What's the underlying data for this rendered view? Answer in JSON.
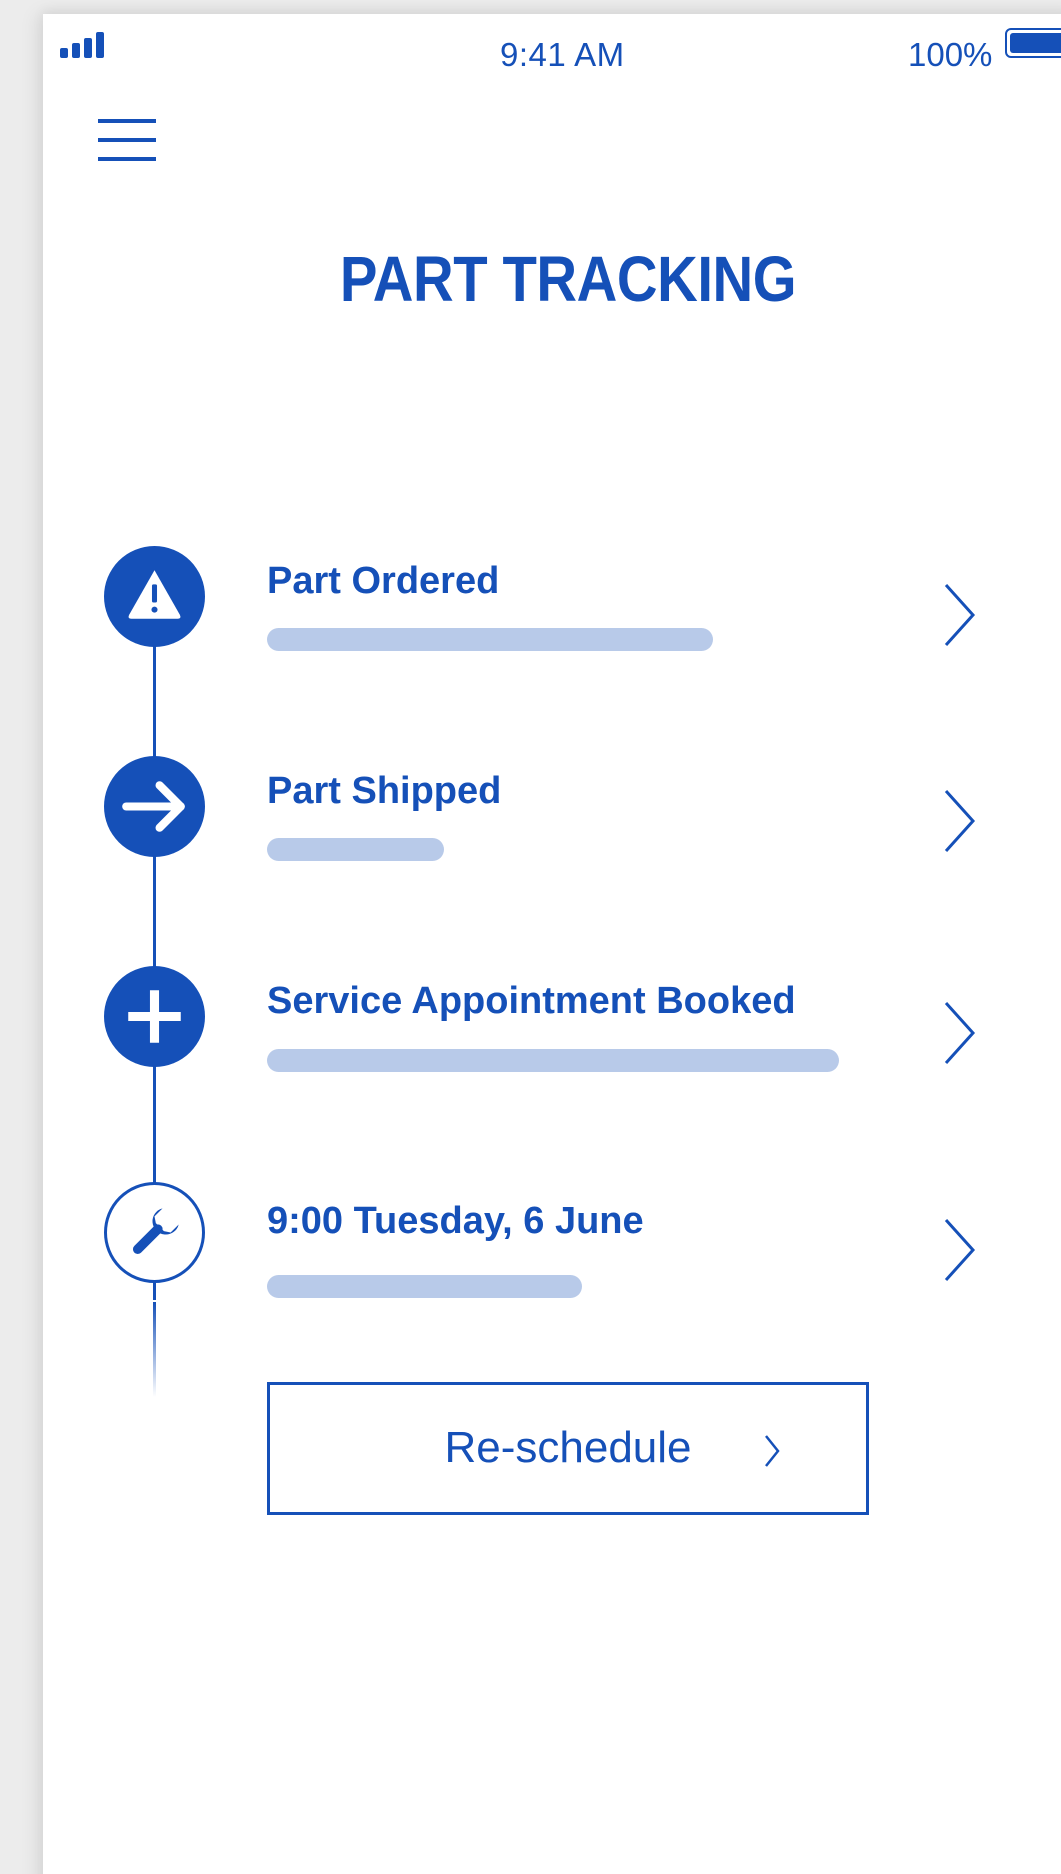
{
  "status_bar": {
    "time": "9:41 AM",
    "battery_percent": "100%",
    "signal_bars": 4,
    "battery_level": 1.0
  },
  "header": {
    "menu_icon": "hamburger-menu-icon",
    "title": "PART TRACKING"
  },
  "steps": [
    {
      "label": "Part Ordered",
      "icon": "warning-triangle-icon",
      "progress": 0.78,
      "completed": true
    },
    {
      "label": "Part Shipped",
      "icon": "arrow-right-icon",
      "progress": 0.31,
      "completed": true
    },
    {
      "label": "Service Appointment Booked",
      "icon": "plus-icon",
      "progress": 1.0,
      "completed": true
    },
    {
      "label": "9:00 Tuesday, 6 June",
      "icon": "wrench-icon",
      "progress": 0.55,
      "completed": false
    }
  ],
  "actions": {
    "reschedule_label": "Re-schedule"
  },
  "colors": {
    "primary": "#1550b8",
    "bar": "#b8cae9",
    "background": "#ffffff"
  }
}
